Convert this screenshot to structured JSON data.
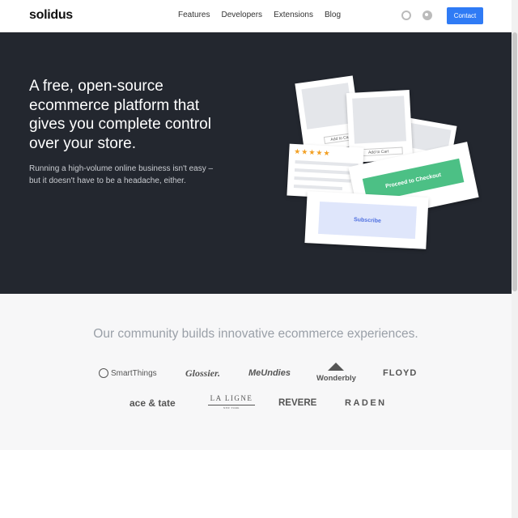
{
  "nav": {
    "logo": "solidus",
    "links": [
      "Features",
      "Developers",
      "Extensions",
      "Blog"
    ],
    "contact_label": "Contact",
    "icons": [
      "slack-icon",
      "github-icon"
    ]
  },
  "hero": {
    "headline": "A free, open-source ecommerce platform that gives you complete control over your store.",
    "subhead": "Running a high-volume online business isn't easy – but it doesn't have to be a headache, either.",
    "illustration": {
      "add_to_cart_1": "Add to Car",
      "add_to_cart_2": "Add to Cart",
      "proceed_label": "Proceed to Checkout",
      "subscribe_label": "Subscribe",
      "stars": "★★★★★"
    }
  },
  "community": {
    "title": "Our community builds innovative ecommerce experiences.",
    "brands": {
      "smartthings": "SmartThings",
      "glossier": "Glossier.",
      "meundies": "MeUndies",
      "wonderbly": "Wonderbly",
      "floyd": "FLOYD",
      "acetate": "ace & tate",
      "lal_igne": "LA LIGNE",
      "lal_igne_sub": "NEW YORK",
      "revere": "REVERE",
      "raden": "RADEN"
    }
  },
  "colors": {
    "hero_bg": "#23272f",
    "accent_blue": "#2f7bf5",
    "checkout_green": "#4cc085",
    "star_orange": "#f2a024"
  }
}
